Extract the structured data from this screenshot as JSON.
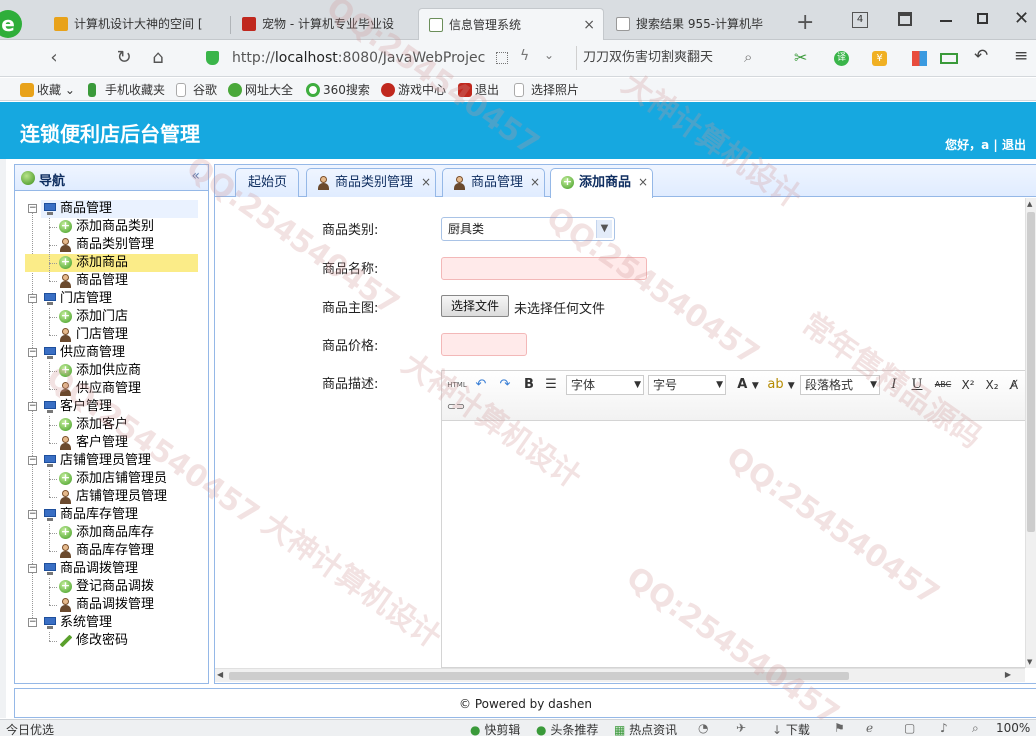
{
  "browser": {
    "tabs": [
      {
        "label": "计算机设计大神的空间 [",
        "color": "#e8a21a"
      },
      {
        "label": "宠物 - 计算机专业毕业设",
        "color": "#c0281e"
      },
      {
        "label": "信息管理系统",
        "color": "#6b8e5a"
      },
      {
        "label": "搜索结果 955-计算机毕",
        "color": "#999999"
      }
    ],
    "tab_close": "×",
    "new_tab": "+",
    "tab_count": "4",
    "url_prefix": "http://",
    "url_domain": "localhost",
    "url_rest": ":8080/JavaWebProjec",
    "search_text": "刀刀双伤害切割爽翻天"
  },
  "bookmarks": [
    {
      "label": "收藏",
      "color": "#e8a21a"
    },
    {
      "label": "手机收藏夹",
      "color": "#3a9a3a"
    },
    {
      "label": "谷歌",
      "color": "#aaaaaa"
    },
    {
      "label": "网址大全",
      "color": "#4aa83a"
    },
    {
      "label": "360搜索",
      "color": "#3fae3f"
    },
    {
      "label": "游戏中心",
      "color": "#c0281e"
    },
    {
      "label": "退出",
      "color": "#c0281e"
    },
    {
      "label": "选择照片",
      "color": "#aaaaaa"
    }
  ],
  "app": {
    "title": "连锁便利店后台管理",
    "user_info": "您好，a | 退出",
    "header_color": "#16a8e0"
  },
  "sidebar": {
    "title": "导航",
    "collapse": "«",
    "groups": [
      {
        "label": "商品管理",
        "items": [
          {
            "label": "添加商品类别",
            "icon": "add-icon"
          },
          {
            "label": "商品类别管理",
            "icon": "user-icon"
          },
          {
            "label": "添加商品",
            "icon": "add-icon",
            "selected": true
          },
          {
            "label": "商品管理",
            "icon": "user-icon"
          }
        ]
      },
      {
        "label": "门店管理",
        "items": [
          {
            "label": "添加门店",
            "icon": "add-icon"
          },
          {
            "label": "门店管理",
            "icon": "user-icon"
          }
        ]
      },
      {
        "label": "供应商管理",
        "items": [
          {
            "label": "添加供应商",
            "icon": "add-icon"
          },
          {
            "label": "供应商管理",
            "icon": "user-icon"
          }
        ]
      },
      {
        "label": "客户管理",
        "items": [
          {
            "label": "添加客户",
            "icon": "add-icon"
          },
          {
            "label": "客户管理",
            "icon": "user-icon"
          }
        ]
      },
      {
        "label": "店铺管理员管理",
        "items": [
          {
            "label": "添加店铺管理员",
            "icon": "add-icon"
          },
          {
            "label": "店铺管理员管理",
            "icon": "user-icon"
          }
        ]
      },
      {
        "label": "商品库存管理",
        "items": [
          {
            "label": "添加商品库存",
            "icon": "add-icon"
          },
          {
            "label": "商品库存管理",
            "icon": "user-icon"
          }
        ]
      },
      {
        "label": "商品调拨管理",
        "items": [
          {
            "label": "登记商品调拨",
            "icon": "add-icon"
          },
          {
            "label": "商品调拨管理",
            "icon": "user-icon"
          }
        ]
      },
      {
        "label": "系统管理",
        "items": [
          {
            "label": "修改密码",
            "icon": "pencil-icon"
          }
        ]
      }
    ]
  },
  "tabs": [
    {
      "label": "起始页",
      "closable": false
    },
    {
      "label": "商品类别管理",
      "closable": true
    },
    {
      "label": "商品管理",
      "closable": true
    },
    {
      "label": "添加商品",
      "closable": true,
      "active": true
    }
  ],
  "form": {
    "category_label": "商品类别:",
    "category_value": "厨具类",
    "name_label": "商品名称:",
    "image_label": "商品主图:",
    "file_button": "选择文件",
    "file_status": "未选择任何文件",
    "price_label": "商品价格:",
    "desc_label": "商品描述:"
  },
  "editor": {
    "html": "HTML",
    "bold": "B",
    "font_family": "字体",
    "font_size": "字号",
    "font_color": "A",
    "paragraph": "段落格式",
    "italic": "I",
    "underline": "U",
    "strike": "ABC",
    "sup": "X²",
    "sub": "X₂"
  },
  "footer": {
    "text": "© Powered by dashen"
  },
  "statusbar": {
    "left": "今日优选",
    "items": [
      "快剪辑",
      "头条推荐",
      "热点资讯",
      "下载"
    ],
    "zoom": "100%"
  },
  "watermarks": [
    "QQ:254540457",
    "大神计算机设计",
    "常年售精品源码"
  ]
}
